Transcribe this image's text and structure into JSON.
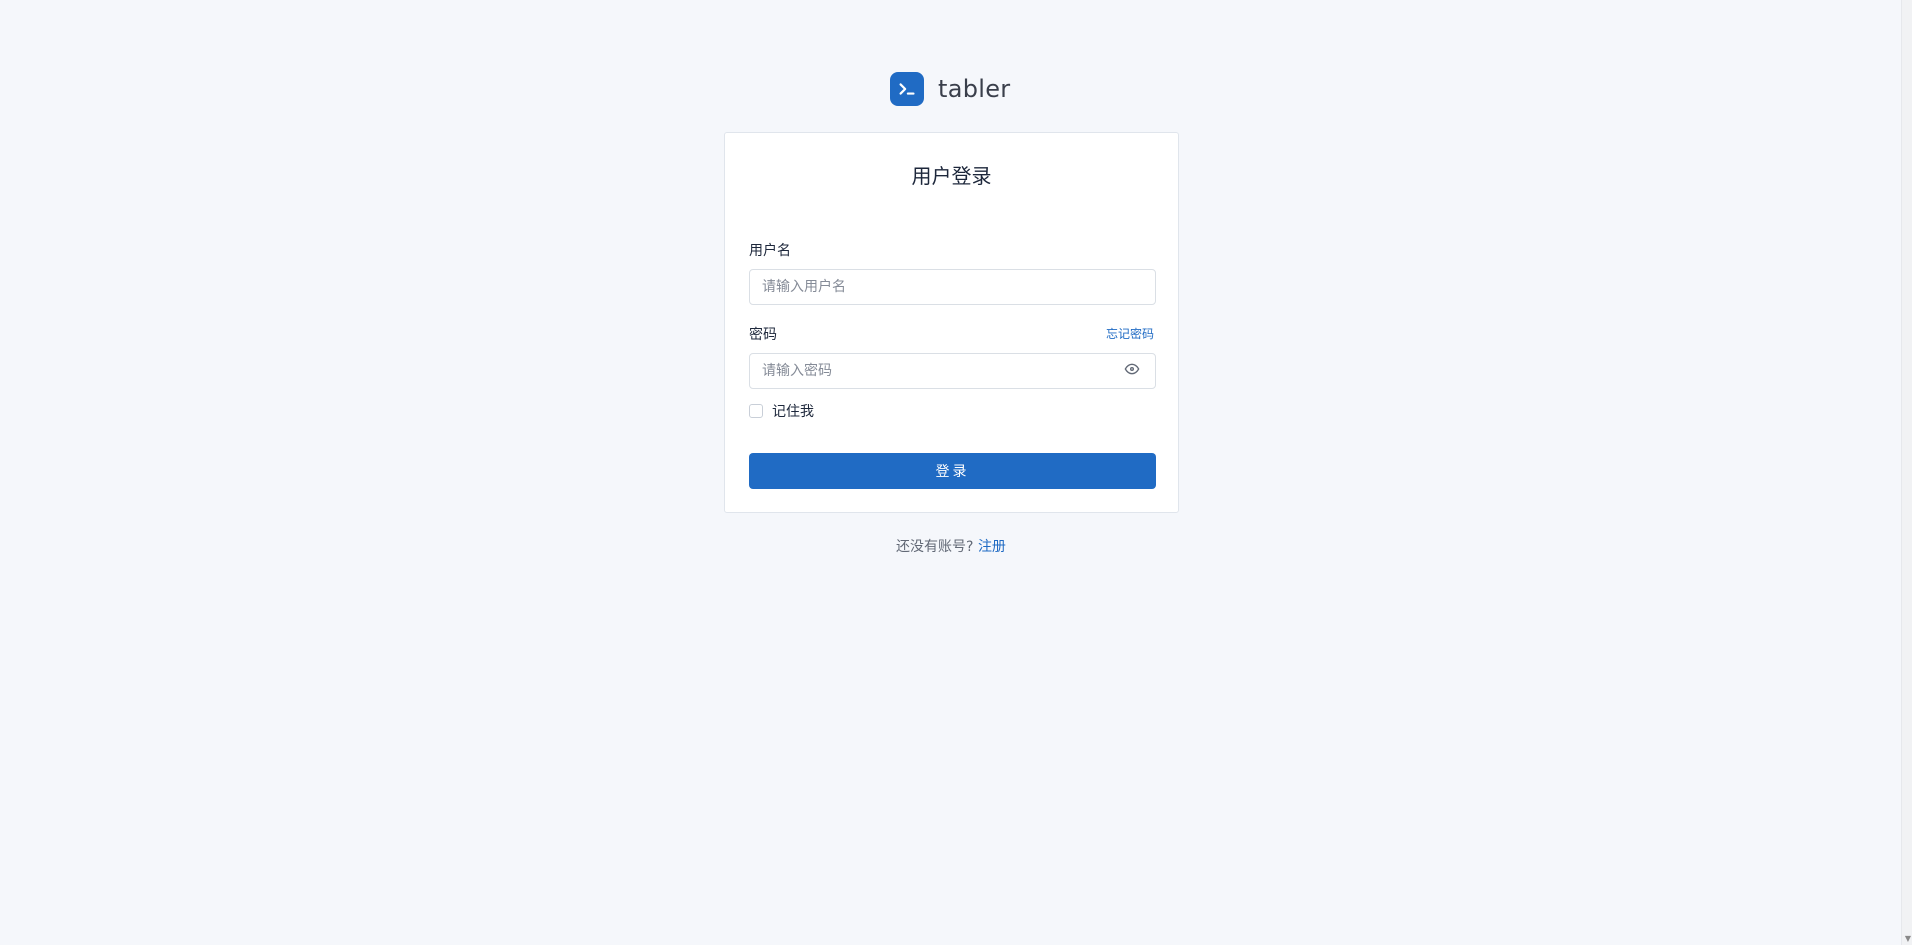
{
  "brand": {
    "name": "tabler",
    "logo_icon": "terminal-icon",
    "color": "#206bc4"
  },
  "login": {
    "title": "用户登录",
    "username": {
      "label": "用户名",
      "placeholder": "请输入用户名",
      "value": ""
    },
    "password": {
      "label": "密码",
      "placeholder": "请输入密码",
      "value": "",
      "forgot_link": "忘记密码",
      "toggle_icon": "eye-icon"
    },
    "remember_label": "记住我",
    "remember_checked": false,
    "submit_label": "登录"
  },
  "footer": {
    "prompt": "还没有账号?",
    "register_link": "注册"
  },
  "colors": {
    "background": "#f5f7fb",
    "primary": "#206bc4",
    "card": "#ffffff"
  }
}
